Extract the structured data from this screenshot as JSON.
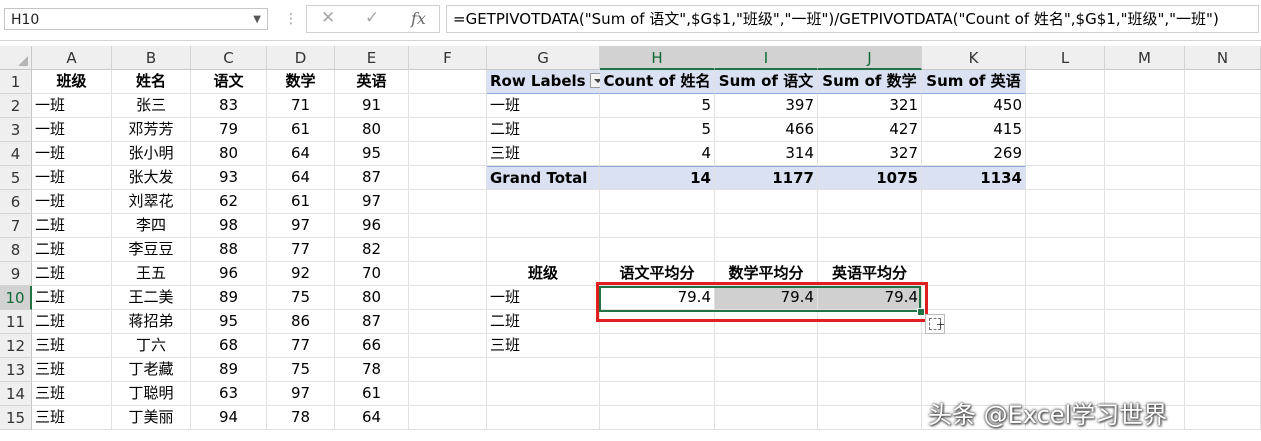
{
  "formula_bar": {
    "name_box": "H10",
    "formula": "=GETPIVOTDATA(\"Sum of 语文\",$G$1,\"班级\",\"一班\")/GETPIVOTDATA(\"Count of 姓名\",$G$1,\"班级\",\"一班\")"
  },
  "columns": [
    "A",
    "B",
    "C",
    "D",
    "E",
    "F",
    "G",
    "H",
    "I",
    "J",
    "K",
    "L",
    "M",
    "N"
  ],
  "rows": [
    "1",
    "2",
    "3",
    "4",
    "5",
    "6",
    "7",
    "8",
    "9",
    "10",
    "11",
    "12",
    "13",
    "14",
    "15"
  ],
  "source_table": {
    "headers": [
      "班级",
      "姓名",
      "语文",
      "数学",
      "英语"
    ],
    "rows": [
      [
        "一班",
        "张三",
        "83",
        "71",
        "91"
      ],
      [
        "一班",
        "邓芳芳",
        "79",
        "61",
        "80"
      ],
      [
        "一班",
        "张小明",
        "80",
        "64",
        "95"
      ],
      [
        "一班",
        "张大发",
        "93",
        "64",
        "87"
      ],
      [
        "一班",
        "刘翠花",
        "62",
        "61",
        "97"
      ],
      [
        "二班",
        "李四",
        "98",
        "97",
        "96"
      ],
      [
        "二班",
        "李豆豆",
        "88",
        "77",
        "82"
      ],
      [
        "二班",
        "王五",
        "96",
        "92",
        "70"
      ],
      [
        "二班",
        "王二美",
        "89",
        "75",
        "80"
      ],
      [
        "二班",
        "蒋招弟",
        "95",
        "86",
        "87"
      ],
      [
        "三班",
        "丁六",
        "68",
        "77",
        "66"
      ],
      [
        "三班",
        "丁老藏",
        "89",
        "75",
        "78"
      ],
      [
        "三班",
        "丁聪明",
        "63",
        "97",
        "61"
      ],
      [
        "三班",
        "丁美丽",
        "94",
        "78",
        "64"
      ]
    ]
  },
  "pivot": {
    "headers": [
      "Row Labels",
      "Count of 姓名",
      "Sum of 语文",
      "Sum of 数学",
      "Sum of 英语"
    ],
    "rows": [
      [
        "一班",
        "5",
        "397",
        "321",
        "450"
      ],
      [
        "二班",
        "5",
        "466",
        "427",
        "415"
      ],
      [
        "三班",
        "4",
        "314",
        "327",
        "269"
      ]
    ],
    "total": [
      "Grand Total",
      "14",
      "1177",
      "1075",
      "1134"
    ]
  },
  "avg_table": {
    "headers": [
      "班级",
      "语文平均分",
      "数学平均分",
      "英语平均分"
    ],
    "rows": [
      [
        "一班",
        "79.4",
        "79.4",
        "79.4"
      ],
      [
        "二班",
        "",
        "",
        ""
      ],
      [
        "三班",
        "",
        "",
        ""
      ]
    ]
  },
  "watermark": "头条 @Excel学习世界"
}
